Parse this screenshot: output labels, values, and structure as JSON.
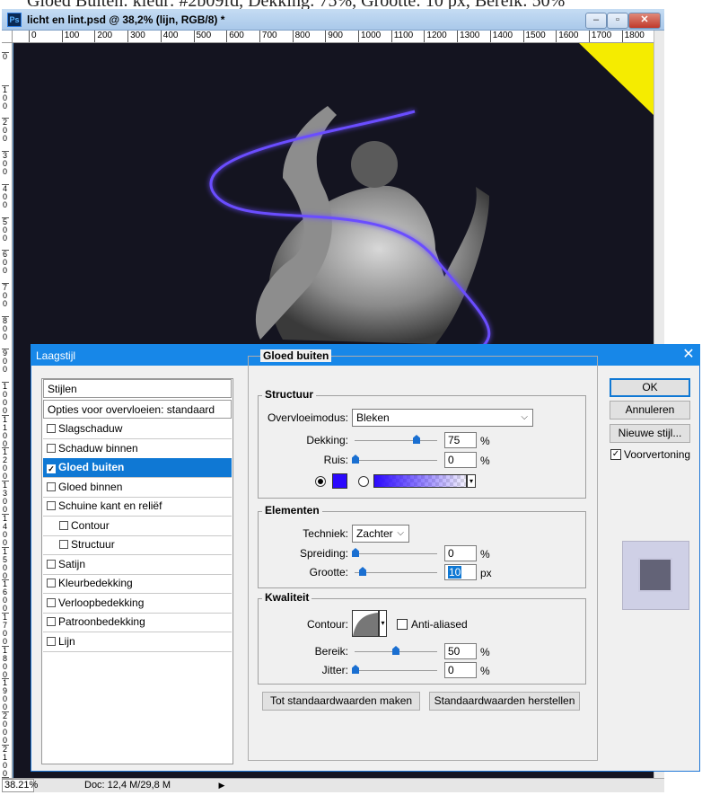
{
  "page_header_fragment": "Gloed Buiten: kleur: #2b09fd, Dekking: 75%, Grootte: 10 px, Bereik: 50%",
  "window": {
    "title": "licht en lint.psd @ 38,2% (lijn, RGB/8) *",
    "app_icon": "Ps",
    "minimize": "–",
    "maximize": "▫",
    "close": "✕"
  },
  "ruler": {
    "horizontal": [
      "0",
      "100",
      "200",
      "300",
      "400",
      "500",
      "600",
      "700",
      "800",
      "900",
      "1000",
      "1100",
      "1200",
      "1300",
      "1400",
      "1500",
      "1600",
      "1700",
      "1800",
      "1"
    ],
    "vertical": [
      "0",
      "100",
      "200",
      "300",
      "400",
      "500",
      "600",
      "700",
      "800",
      "900",
      "1000",
      "1100",
      "1200",
      "1300",
      "1400",
      "1500",
      "1600",
      "1700",
      "1800",
      "1900",
      "2000",
      "2100",
      "2200"
    ]
  },
  "statusbar": {
    "zoom": "38.21%",
    "doc": "Doc: 12,4 M/29,8 M",
    "arrow": "▶"
  },
  "dialog": {
    "title": "Laagstijl",
    "close": "✕",
    "list": {
      "header": "Stijlen",
      "blend": "Opties voor overvloeien: standaard",
      "items": [
        {
          "label": "Slagschaduw",
          "checked": false,
          "indent": false
        },
        {
          "label": "Schaduw binnen",
          "checked": false,
          "indent": false
        },
        {
          "label": "Gloed buiten",
          "checked": true,
          "indent": false,
          "selected": true
        },
        {
          "label": "Gloed binnen",
          "checked": false,
          "indent": false
        },
        {
          "label": "Schuine kant en reliëf",
          "checked": false,
          "indent": false
        },
        {
          "label": "Contour",
          "checked": false,
          "indent": true
        },
        {
          "label": "Structuur",
          "checked": false,
          "indent": true
        },
        {
          "label": "Satijn",
          "checked": false,
          "indent": false
        },
        {
          "label": "Kleurbedekking",
          "checked": false,
          "indent": false
        },
        {
          "label": "Verloopbedekking",
          "checked": false,
          "indent": false
        },
        {
          "label": "Patroonbedekking",
          "checked": false,
          "indent": false
        },
        {
          "label": "Lijn",
          "checked": false,
          "indent": false
        }
      ]
    },
    "panel": {
      "title": "Gloed buiten",
      "structuur": {
        "title": "Structuur",
        "blend_label": "Overvloeimodus:",
        "blend_value": "Bleken",
        "opacity_label": "Dekking:",
        "opacity_value": "75",
        "opacity_unit": "%",
        "noise_label": "Ruis:",
        "noise_value": "0",
        "noise_unit": "%",
        "glow_color": "#2b09fd",
        "gradient_from": "#2b09fd"
      },
      "elementen": {
        "title": "Elementen",
        "technique_label": "Techniek:",
        "technique_value": "Zachter",
        "spread_label": "Spreiding:",
        "spread_value": "0",
        "spread_unit": "%",
        "size_label": "Grootte:",
        "size_value": "10",
        "size_unit": "px"
      },
      "kwaliteit": {
        "title": "Kwaliteit",
        "contour_label": "Contour:",
        "antialias_label": "Anti-aliased",
        "range_label": "Bereik:",
        "range_value": "50",
        "range_unit": "%",
        "jitter_label": "Jitter:",
        "jitter_value": "0",
        "jitter_unit": "%"
      },
      "make_default": "Tot standaardwaarden maken",
      "reset_default": "Standaardwaarden herstellen"
    },
    "buttons": {
      "ok": "OK",
      "cancel": "Annuleren",
      "new_style": "Nieuwe stijl...",
      "preview_label": "Voorvertoning",
      "preview_checked": "✓"
    }
  }
}
